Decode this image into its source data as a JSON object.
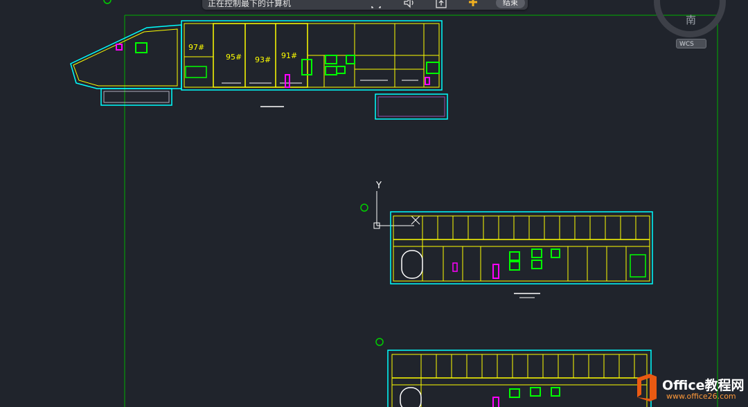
{
  "toolbar": {
    "status_text": "正在控制最下的计算机",
    "end_label": "结束",
    "buttons": [
      "screen-icon",
      "speaker-icon",
      "upload-icon",
      "plus-icon"
    ]
  },
  "viewcube": {
    "compass_label": "南",
    "ucs_label": "WCS"
  },
  "drawing": {
    "room_labels": [
      "97#",
      "95#",
      "93#",
      "91#"
    ],
    "axis_y_label": "Y",
    "colors": {
      "background": "#20242c",
      "wall": "#ffff00",
      "outline": "#00ffff",
      "border": "#00c000",
      "fixture": "#ff00ff",
      "green_fill": "#00e000"
    }
  },
  "watermark": {
    "brand": "Office教程网",
    "url": "www.office26.com"
  }
}
